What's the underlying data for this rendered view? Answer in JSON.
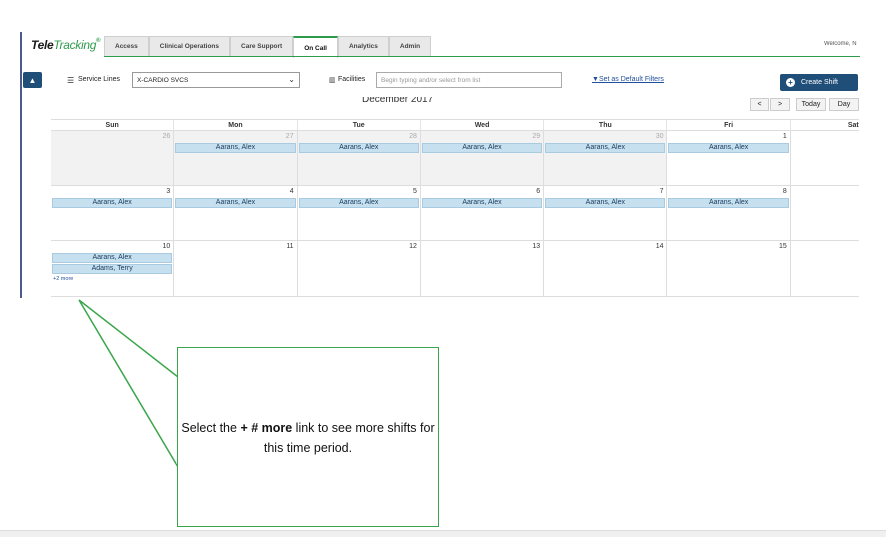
{
  "logo": {
    "tele": "Tele",
    "track": "Tracking",
    "reg": "®"
  },
  "nav": {
    "tabs": [
      {
        "label": "Access",
        "active": false
      },
      {
        "label": "Clinical Operations",
        "active": false
      },
      {
        "label": "Care Support",
        "active": false
      },
      {
        "label": "On Call",
        "active": true
      },
      {
        "label": "Analytics",
        "active": false
      },
      {
        "label": "Admin",
        "active": false
      }
    ],
    "welcome": "Welcome, N"
  },
  "filters": {
    "collapse_icon": "chevron-up-icon",
    "service_lines_label": "Service Lines",
    "service_lines_value": "X-CARDIO SVCS",
    "facilities_label": "Facilities",
    "facilities_placeholder": "Begin typing and/or select from list",
    "default_filters_link": "Set as Default Filters",
    "create_shift_label": "Create Shift"
  },
  "calendar": {
    "month_title": "December 2017",
    "prev": "<",
    "next": ">",
    "today": "Today",
    "day_view": "Day",
    "days_of_week": [
      "Sun",
      "Mon",
      "Tue",
      "Wed",
      "Thu",
      "Fri",
      "Sat"
    ],
    "weeks": [
      [
        {
          "num": "26",
          "other": true,
          "shifts": []
        },
        {
          "num": "27",
          "other": true,
          "shifts": [
            "Aarans, Alex"
          ]
        },
        {
          "num": "28",
          "other": true,
          "shifts": [
            "Aarans, Alex"
          ]
        },
        {
          "num": "29",
          "other": true,
          "shifts": [
            "Aarans, Alex"
          ]
        },
        {
          "num": "30",
          "other": true,
          "shifts": [
            "Aarans, Alex"
          ]
        },
        {
          "num": "1",
          "other": false,
          "shifts": [
            "Aarans, Alex"
          ]
        },
        {
          "num": "",
          "other": false,
          "shifts": []
        }
      ],
      [
        {
          "num": "3",
          "other": false,
          "shifts": [
            "Aarans, Alex"
          ]
        },
        {
          "num": "4",
          "other": false,
          "shifts": [
            "Aarans, Alex"
          ]
        },
        {
          "num": "5",
          "other": false,
          "shifts": [
            "Aarans, Alex"
          ]
        },
        {
          "num": "6",
          "other": false,
          "shifts": [
            "Aarans, Alex"
          ]
        },
        {
          "num": "7",
          "other": false,
          "shifts": [
            "Aarans, Alex"
          ]
        },
        {
          "num": "8",
          "other": false,
          "shifts": [
            "Aarans, Alex"
          ]
        },
        {
          "num": "",
          "other": false,
          "shifts": []
        }
      ],
      [
        {
          "num": "10",
          "other": false,
          "shifts": [
            "Aarans, Alex",
            "Adams, Terry"
          ],
          "more": "+2 more"
        },
        {
          "num": "11",
          "other": false,
          "shifts": []
        },
        {
          "num": "12",
          "other": false,
          "shifts": []
        },
        {
          "num": "13",
          "other": false,
          "shifts": []
        },
        {
          "num": "14",
          "other": false,
          "shifts": []
        },
        {
          "num": "15",
          "other": false,
          "shifts": []
        },
        {
          "num": "",
          "other": false,
          "shifts": []
        }
      ]
    ]
  },
  "callout": {
    "text_before": "Select the ",
    "text_bold": "+ # more",
    "text_after": " link to see more shifts for this time period.",
    "border_color": "#3aa64c"
  }
}
